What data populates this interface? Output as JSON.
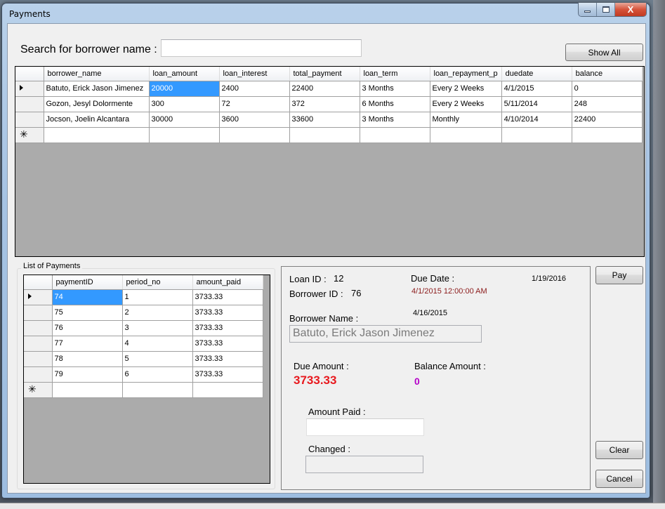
{
  "window": {
    "title": "Payments",
    "minimize_glyph": "minimize",
    "maximize_glyph": "maximize",
    "close_glyph": "X"
  },
  "search": {
    "label": "Search for borrower name :",
    "value": "",
    "placeholder": ""
  },
  "buttons": {
    "show_all": "Show All",
    "pay": "Pay",
    "clear": "Clear",
    "cancel": "Cancel"
  },
  "loans_grid": {
    "columns": [
      "borrower_name",
      "loan_amount",
      "loan_interest",
      "total_payment",
      "loan_term",
      "loan_repayment_p",
      "duedate",
      "balance"
    ],
    "rows": [
      [
        "Batuto, Erick Jason Jimenez",
        "20000",
        "2400",
        "22400",
        "3 Months",
        "Every 2 Weeks",
        "4/1/2015",
        "0"
      ],
      [
        "Gozon, Jesyl Dolormente",
        "300",
        "72",
        "372",
        "6 Months",
        "Every 2 Weeks",
        "5/11/2014",
        "248"
      ],
      [
        "Jocson, Joelin Alcantara",
        "30000",
        "3600",
        "33600",
        "3 Months",
        "Monthly",
        "4/10/2014",
        "22400"
      ]
    ],
    "current_row_icon": "row-pointer-arrow",
    "new_row_icon": "new-row-asterisk",
    "new_row_glyph": "*",
    "selected_cell": {
      "row": 0,
      "column": "loan_amount"
    }
  },
  "payments_group": {
    "label": "List of Payments",
    "columns": [
      "paymentID",
      "period_no",
      "amount_paid"
    ],
    "rows": [
      [
        "74",
        "1",
        "3733.33"
      ],
      [
        "75",
        "2",
        "3733.33"
      ],
      [
        "76",
        "3",
        "3733.33"
      ],
      [
        "77",
        "4",
        "3733.33"
      ],
      [
        "78",
        "5",
        "3733.33"
      ],
      [
        "79",
        "6",
        "3733.33"
      ]
    ],
    "new_row_glyph": "*",
    "selected_cell": {
      "row": 0,
      "column": "paymentID"
    }
  },
  "details": {
    "loan_id_label": "Loan ID :",
    "loan_id": "12",
    "borrower_id_label": "Borrower ID :",
    "borrower_id": "76",
    "due_date_label": "Due Date :",
    "due_date_value": "4/1/2015 12:00:00 AM",
    "current_date": "1/19/2016",
    "next_date": "4/16/2015",
    "borrower_name_label": "Borrower Name :",
    "borrower_name": "Batuto, Erick Jason Jimenez",
    "due_amount_label": "Due Amount :",
    "due_amount": "3733.33",
    "balance_amount_label": "Balance Amount :",
    "balance_amount": "0",
    "amount_paid_label": "Amount Paid :",
    "amount_paid": "",
    "changed_label": "Changed :",
    "changed": ""
  },
  "colors": {
    "selection": "#3399ff",
    "due_amount": "#e8191e",
    "balance_amount": "#b400c8",
    "due_date_value": "#8b1a1a",
    "grid_background": "#ababab"
  }
}
